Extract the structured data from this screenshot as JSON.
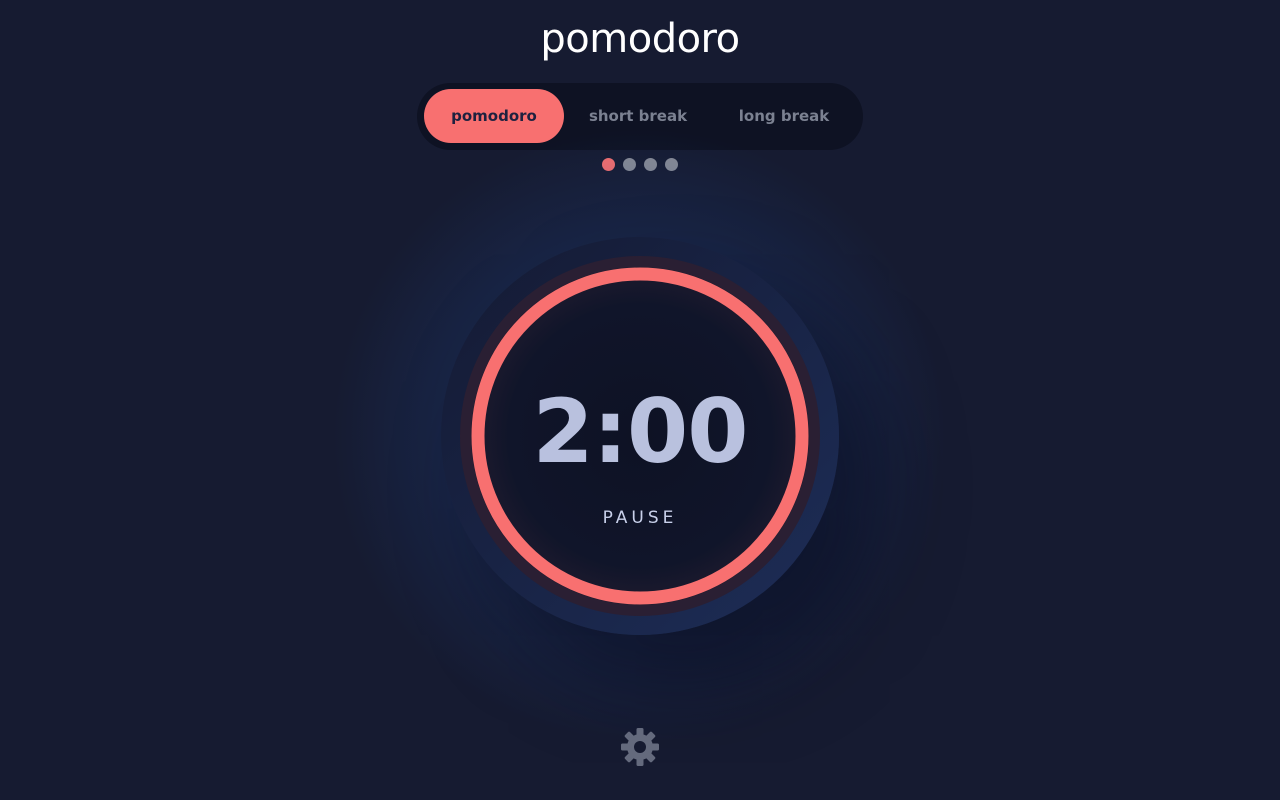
{
  "app": {
    "title": "pomodoro"
  },
  "tabs": [
    {
      "label": "pomodoro",
      "active": true
    },
    {
      "label": "short break",
      "active": false
    },
    {
      "label": "long break",
      "active": false
    }
  ],
  "session_dots": {
    "total": 4,
    "completed": 1
  },
  "timer": {
    "time": "2:00",
    "action_label": "PAUSE",
    "progress": 1.0
  },
  "settings": {
    "icon": "gear-icon"
  },
  "colors": {
    "accent": "#f87070",
    "background": "#161b31",
    "text": "#d7e0ff",
    "inactive_dot": "#8a8d97"
  }
}
